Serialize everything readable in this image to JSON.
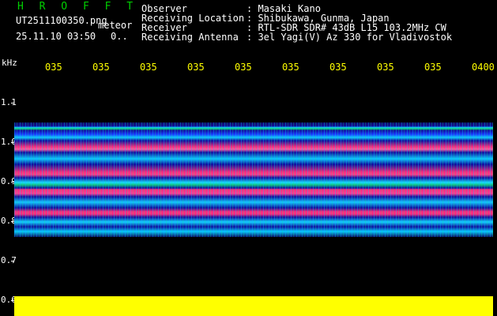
{
  "header": {
    "brand": "H R O F F T",
    "file_name": "UT2511100350.png",
    "meteor_label": "meteor",
    "date_time": "25.11.10 03:50",
    "count_text": "0.."
  },
  "info": [
    {
      "label": "Observer",
      "value": ": Masaki Kano"
    },
    {
      "label": "Receiving Location",
      "value": ": Shibukawa, Gunma, Japan"
    },
    {
      "label": "Receiver",
      "value": ": RTL-SDR SDR# 43dB L15 103.2MHz CW"
    },
    {
      "label": "Receiving Antenna",
      "value": ": 3el Yagi(V) Az 330 for Vladivostok"
    }
  ],
  "axis": {
    "unit": "kHz",
    "time_labels": [
      "035",
      "035",
      "035",
      "035",
      "035",
      "035",
      "035",
      "035",
      "035",
      "0400"
    ],
    "freq_labels": [
      "1.1",
      "1.0",
      "0.9",
      "0.8",
      "0.7",
      "0.6"
    ]
  },
  "colors": {
    "text": "#ffffff",
    "brand": "#00d000",
    "time_axis": "#ffff00",
    "background": "#000000",
    "signal_level": "#ffff00",
    "spectrogram_base": "#0a0a96",
    "band_pink": "#ff2d80",
    "band_cyan": "#18c0ff"
  }
}
